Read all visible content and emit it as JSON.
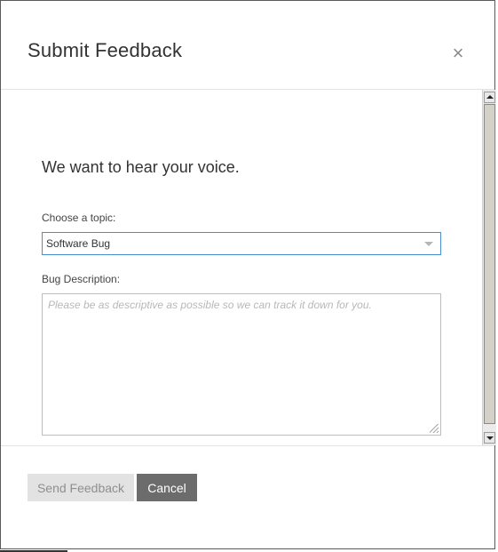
{
  "dialog": {
    "title": "Submit Feedback",
    "close_symbol": "×"
  },
  "form": {
    "headline": "We want to hear your voice.",
    "topic_label": "Choose a topic:",
    "topic_value": "Software Bug",
    "description_label": "Bug Description:",
    "description_placeholder": "Please be as descriptive as possible so we can track it down for you."
  },
  "footer": {
    "send_label": "Send Feedback",
    "cancel_label": "Cancel"
  },
  "icons": {
    "close": "close-icon",
    "dropdown": "chevron-down-icon",
    "resize": "resize-grip-icon",
    "scroll_up": "scroll-up-arrow-icon",
    "scroll_down": "scroll-down-arrow-icon"
  },
  "colors": {
    "focus_border": "#4a8fcf",
    "cancel_bg": "#6c6c6c",
    "send_bg_disabled": "#e2e2e2"
  }
}
